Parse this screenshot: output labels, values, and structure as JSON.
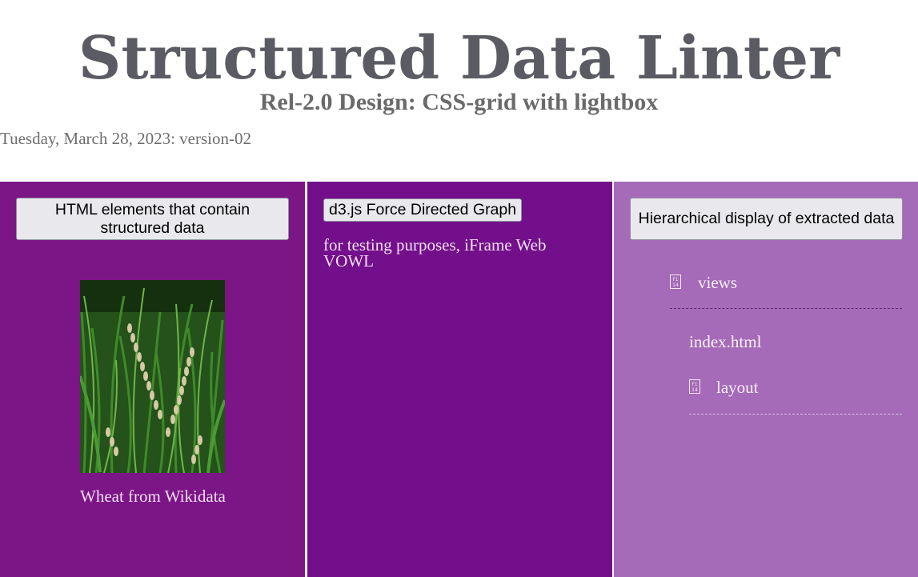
{
  "header": {
    "title": "Structured Data Linter",
    "subtitle": "Rel-2.0 Design: CSS-grid with lightbox",
    "dateline": "Tuesday, March 28, 2023: version-02"
  },
  "panels": {
    "left": {
      "button_label": "HTML elements that contain structured data",
      "image_name": "wheat-photo",
      "caption": "Wheat from Wikidata",
      "background": "#7c1586"
    },
    "middle": {
      "button_label": "d3.js Force Directed Graph",
      "note": "for testing purposes, iFrame Web VOWL",
      "background": "#730f8a"
    },
    "right": {
      "button_label": "Hierarchical display of extracted data",
      "background": "#a56ab8",
      "tree": [
        {
          "label": "views",
          "icon": "folder-icon"
        },
        {
          "label": "index.html",
          "icon": ""
        },
        {
          "label": "layout",
          "icon": "folder-icon"
        }
      ]
    }
  }
}
